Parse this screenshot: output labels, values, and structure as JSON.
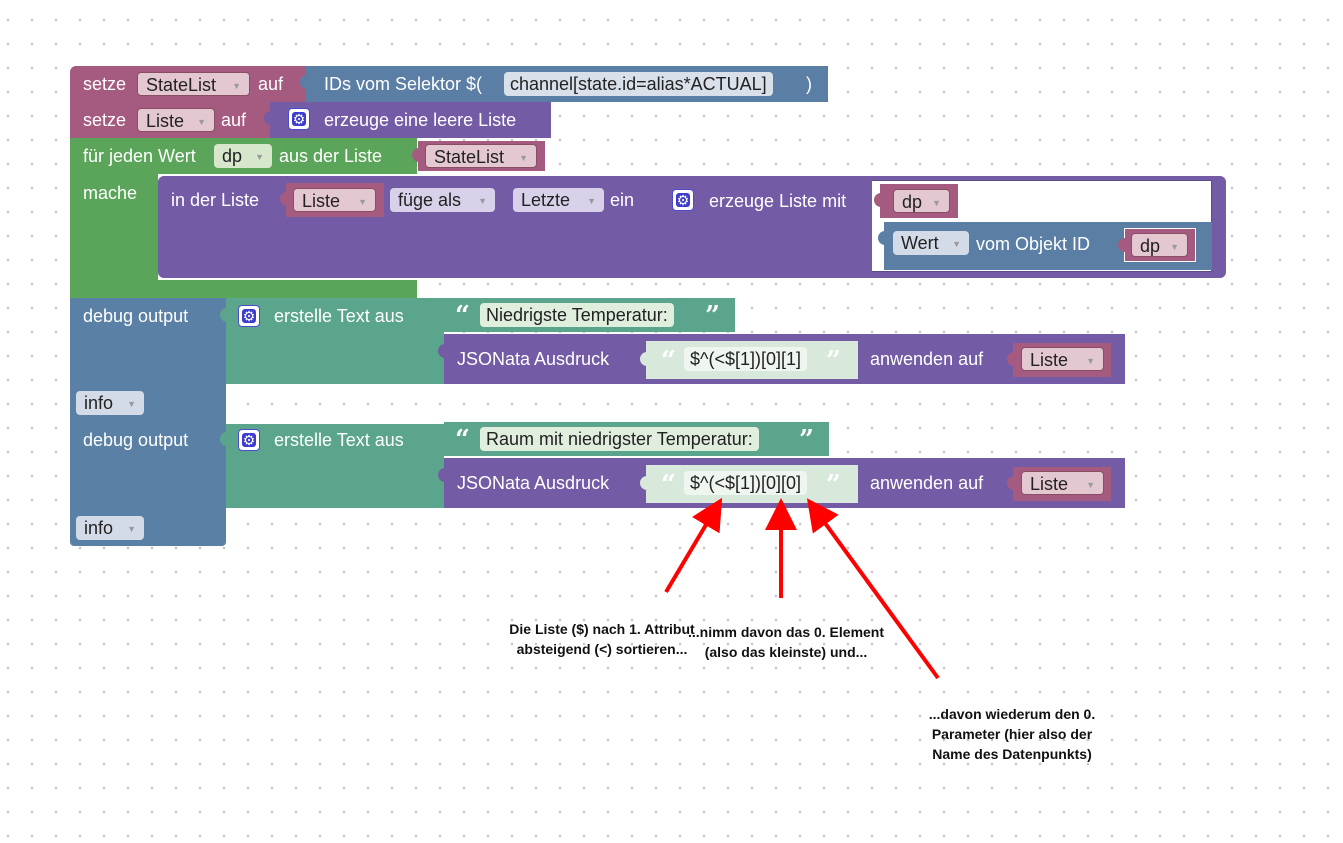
{
  "colors": {
    "variables": "#a55b80",
    "lists": "#745ba5",
    "loops": "#5ba55b",
    "debug": "#5b80a5",
    "text": "#5ba58c",
    "selector": "#5b7ea5",
    "arrow": "#ff0000"
  },
  "blocks": {
    "set1": {
      "setze": "setze",
      "var": "StateList",
      "auf": "auf",
      "selector_label": "IDs vom Selektor $(",
      "selector_value": "channel[state.id=alias*ACTUAL]",
      "close": ")"
    },
    "set2": {
      "setze": "setze",
      "var": "Liste",
      "auf": "auf",
      "create_empty": "erzeuge eine leere Liste"
    },
    "foreach": {
      "label": "für jeden Wert",
      "var": "dp",
      "from": "aus der Liste",
      "list": "StateList",
      "do": "mache"
    },
    "inlist": {
      "label": "in der Liste",
      "list": "Liste",
      "mode": "füge als",
      "where": "Letzte",
      "ein": "ein",
      "create_with": "erzeuge Liste mit",
      "item1": "dp",
      "value": "Wert",
      "from_obj": "vom Objekt ID",
      "item2": "dp"
    },
    "debug1": {
      "label": "debug output",
      "create_text": "erstelle Text aus",
      "string": "Niedrigste Temperatur:",
      "jsonata": "JSONata Ausdruck",
      "expr": "$^(<$[1])[0][1]",
      "apply": "anwenden auf",
      "list": "Liste",
      "level": "info"
    },
    "debug2": {
      "label": "debug output",
      "create_text": "erstelle Text aus",
      "string": "Raum mit niedrigster Temperatur:",
      "jsonata": "JSONata Ausdruck",
      "expr": "$^(<$[1])[0][0]",
      "apply": "anwenden auf",
      "list": "Liste",
      "level": "info"
    }
  },
  "quotes": {
    "open": "“",
    "close": "”"
  },
  "annotations": {
    "a1": "Die Liste ($) nach 1. Attribut absteigend (<) sortieren...",
    "a2": "...nimm davon das 0. Element (also das kleinste) und...",
    "a3": "...davon wiederum den 0. Parameter (hier also der Name des Datenpunkts)"
  }
}
